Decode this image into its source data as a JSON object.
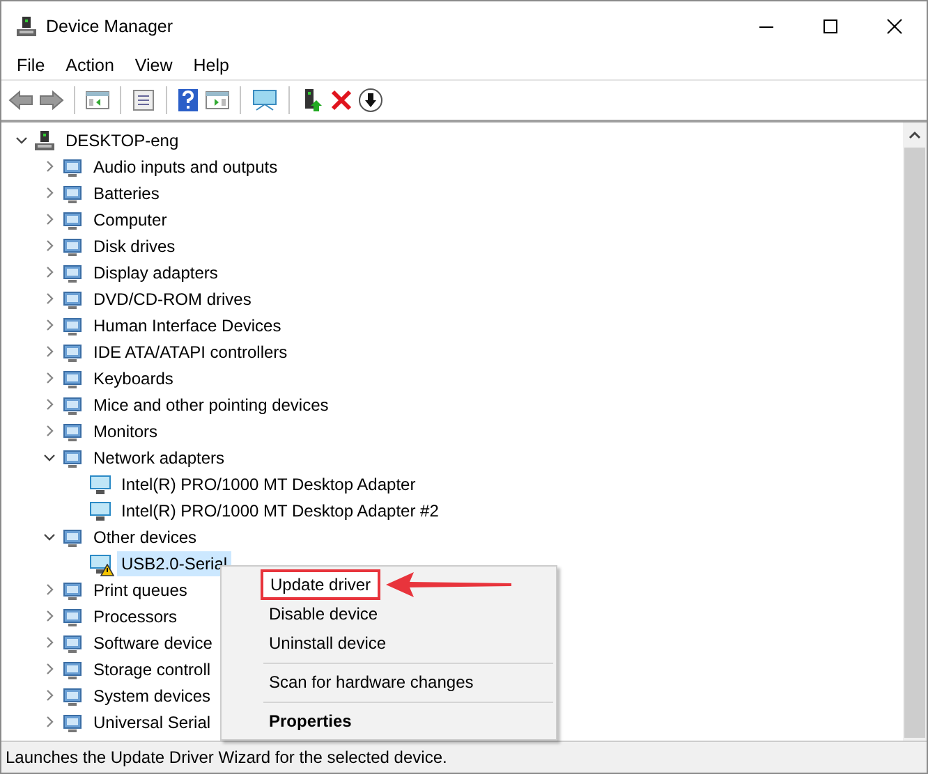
{
  "window": {
    "title": "Device Manager"
  },
  "menu_bar": [
    "File",
    "Action",
    "View",
    "Help"
  ],
  "tree": [
    {
      "label": "DESKTOP-eng",
      "expanded": true,
      "selected": false,
      "children": [
        {
          "label": "Audio inputs and outputs",
          "expanded": false,
          "selected": false
        },
        {
          "label": "Batteries",
          "expanded": false,
          "selected": false
        },
        {
          "label": "Computer",
          "expanded": false,
          "selected": false
        },
        {
          "label": "Disk drives",
          "expanded": false,
          "selected": false
        },
        {
          "label": "Display adapters",
          "expanded": false,
          "selected": false
        },
        {
          "label": "DVD/CD-ROM drives",
          "expanded": false,
          "selected": false
        },
        {
          "label": "Human Interface Devices",
          "expanded": false,
          "selected": false
        },
        {
          "label": "IDE ATA/ATAPI controllers",
          "expanded": false,
          "selected": false
        },
        {
          "label": "Keyboards",
          "expanded": false,
          "selected": false
        },
        {
          "label": "Mice and other pointing devices",
          "expanded": false,
          "selected": false
        },
        {
          "label": "Monitors",
          "expanded": false,
          "selected": false
        },
        {
          "label": "Network adapters",
          "expanded": true,
          "selected": false,
          "children": [
            {
              "label": "Intel(R) PRO/1000 MT Desktop Adapter",
              "selected": false,
              "warning": false
            },
            {
              "label": "Intel(R) PRO/1000 MT Desktop Adapter #2",
              "selected": false,
              "warning": false
            }
          ]
        },
        {
          "label": "Other devices",
          "expanded": true,
          "selected": false,
          "children": [
            {
              "label": "USB2.0-Serial",
              "selected": true,
              "warning": true
            }
          ]
        },
        {
          "label": "Print queues",
          "expanded": false,
          "selected": false
        },
        {
          "label": "Processors",
          "expanded": false,
          "selected": false
        },
        {
          "label": "Software device",
          "expanded": false,
          "selected": false
        },
        {
          "label": "Storage controll",
          "expanded": false,
          "selected": false
        },
        {
          "label": "System devices",
          "expanded": false,
          "selected": false
        },
        {
          "label": "Universal Serial",
          "expanded": false,
          "selected": false
        }
      ]
    }
  ],
  "context_menu": [
    {
      "kind": "item",
      "label": "Update driver",
      "selected": true
    },
    {
      "kind": "item",
      "label": "Disable device",
      "selected": false
    },
    {
      "kind": "item",
      "label": "Uninstall device",
      "selected": false
    },
    {
      "kind": "separator"
    },
    {
      "kind": "item",
      "label": "Scan for hardware changes",
      "selected": false
    },
    {
      "kind": "separator"
    },
    {
      "kind": "default",
      "label": "Properties",
      "selected": false
    }
  ],
  "status_bar": "Launches the Update Driver Wizard for the selected device."
}
